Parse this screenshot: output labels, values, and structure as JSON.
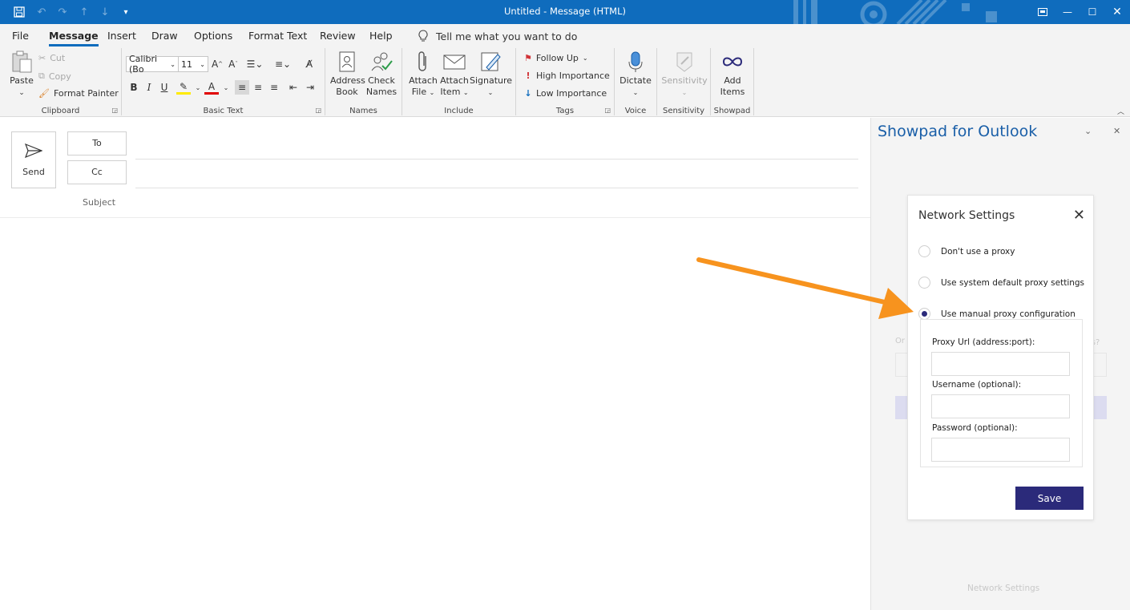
{
  "window": {
    "title": "Untitled  -  Message (HTML)"
  },
  "menu": {
    "tabs": [
      "File",
      "Message",
      "Insert",
      "Draw",
      "Options",
      "Format Text",
      "Review",
      "Help"
    ],
    "tell_me": "Tell me what you want to do"
  },
  "ribbon": {
    "clipboard": {
      "paste": "Paste",
      "cut": "Cut",
      "copy": "Copy",
      "format_painter": "Format Painter",
      "label": "Clipboard"
    },
    "basic_text": {
      "font": "Calibri (Bo",
      "size": "11",
      "label": "Basic Text"
    },
    "names": {
      "address_book_1": "Address",
      "address_book_2": "Book",
      "check_names_1": "Check",
      "check_names_2": "Names",
      "label": "Names"
    },
    "include": {
      "attach_file_1": "Attach",
      "attach_file_2": "File",
      "attach_item_1": "Attach",
      "attach_item_2": "Item",
      "signature": "Signature",
      "label": "Include"
    },
    "tags": {
      "follow_up": "Follow Up",
      "high_importance": "High Importance",
      "low_importance": "Low Importance",
      "label": "Tags"
    },
    "voice": {
      "dictate": "Dictate",
      "label": "Voice"
    },
    "sensitivity": {
      "button": "Sensitivity",
      "label": "Sensitivity"
    },
    "showpad": {
      "add_1": "Add",
      "add_2": "Items",
      "label": "Showpad"
    }
  },
  "compose": {
    "send": "Send",
    "to": "To",
    "cc": "Cc",
    "subject": "Subject"
  },
  "pane": {
    "title": "Showpad for Outlook",
    "footer": "Network Settings",
    "ghost_left": "Or",
    "ghost_right": "is?"
  },
  "dialog": {
    "title": "Network Settings",
    "options": [
      {
        "label": "Don't use a proxy",
        "selected": false
      },
      {
        "label": "Use system default proxy settings",
        "selected": false
      },
      {
        "label": "Use manual proxy configuration",
        "selected": true
      }
    ],
    "proxy_url_label": "Proxy Url (address:port):",
    "username_label": "Username (optional):",
    "password_label": "Password (optional):",
    "proxy_url_value": "",
    "username_value": "",
    "password_value": "",
    "save": "Save"
  },
  "colors": {
    "titlebar": "#0f6cbd",
    "accent": "#2b2a7a",
    "arrow": "#f7931e",
    "pane_title": "#1a5fa8"
  }
}
